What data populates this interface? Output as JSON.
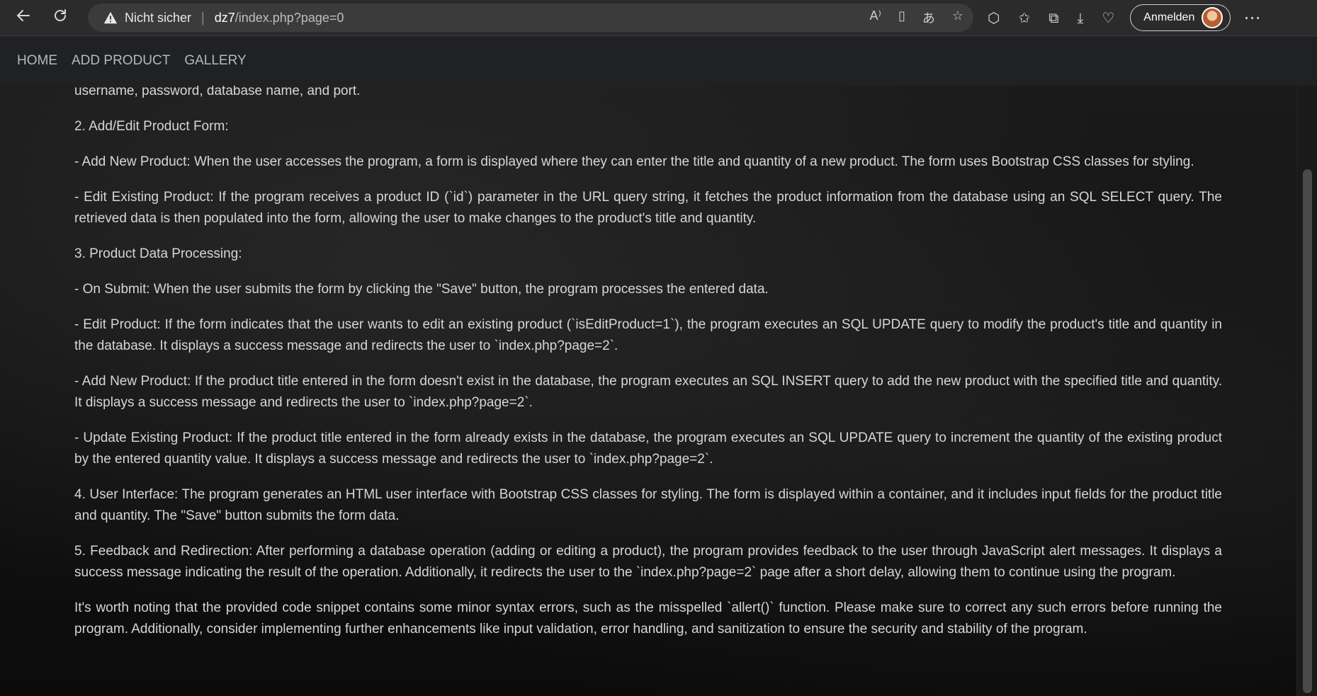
{
  "browser": {
    "not_secure": "Nicht sicher",
    "url_host": "dz7",
    "url_path": "/index.php?page=0",
    "sign_in": "Anmelden"
  },
  "navbar": {
    "items": [
      {
        "label": "HOME"
      },
      {
        "label": "ADD PRODUCT"
      },
      {
        "label": "GALLERY"
      }
    ]
  },
  "content": {
    "paragraphs": [
      "username, password, database name, and port.",
      "2. Add/Edit Product Form:",
      "- Add New Product: When the user accesses the program, a form is displayed where they can enter the title and quantity of a new product. The form uses Bootstrap CSS classes for styling.",
      "- Edit Existing Product: If the program receives a product ID (`id`) parameter in the URL query string, it fetches the product information from the database using an SQL SELECT query. The retrieved data is then populated into the form, allowing the user to make changes to the product's title and quantity.",
      "3. Product Data Processing:",
      "- On Submit: When the user submits the form by clicking the \"Save\" button, the program processes the entered data.",
      "- Edit Product: If the form indicates that the user wants to edit an existing product (`isEditProduct=1`), the program executes an SQL UPDATE query to modify the product's title and quantity in the database. It displays a success message and redirects the user to `index.php?page=2`.",
      "- Add New Product: If the product title entered in the form doesn't exist in the database, the program executes an SQL INSERT query to add the new product with the specified title and quantity. It displays a success message and redirects the user to `index.php?page=2`.",
      "- Update Existing Product: If the product title entered in the form already exists in the database, the program executes an SQL UPDATE query to increment the quantity of the existing product by the entered quantity value. It displays a success message and redirects the user to `index.php?page=2`.",
      "4. User Interface: The program generates an HTML user interface with Bootstrap CSS classes for styling. The form is displayed within a container, and it includes input fields for the product title and quantity. The \"Save\" button submits the form data.",
      "5. Feedback and Redirection: After performing a database operation (adding or editing a product), the program provides feedback to the user through JavaScript alert messages. It displays a success message indicating the result of the operation. Additionally, it redirects the user to the `index.php?page=2` page after a short delay, allowing them to continue using the program.",
      "It's worth noting that the provided code snippet contains some minor syntax errors, such as the misspelled `allert()` function. Please make sure to correct any such errors before running the program. Additionally, consider implementing further enhancements like input validation, error handling, and sanitization to ensure the security and stability of the program."
    ]
  },
  "icons": [
    "back-icon",
    "refresh-icon",
    "warning-icon",
    "read-aloud-icon",
    "immersive-reader-icon",
    "translate-icon",
    "favorite-star-icon",
    "extensions-icon",
    "favorites-icon",
    "collections-icon",
    "downloads-icon",
    "browser-essentials-icon",
    "more-icon"
  ]
}
